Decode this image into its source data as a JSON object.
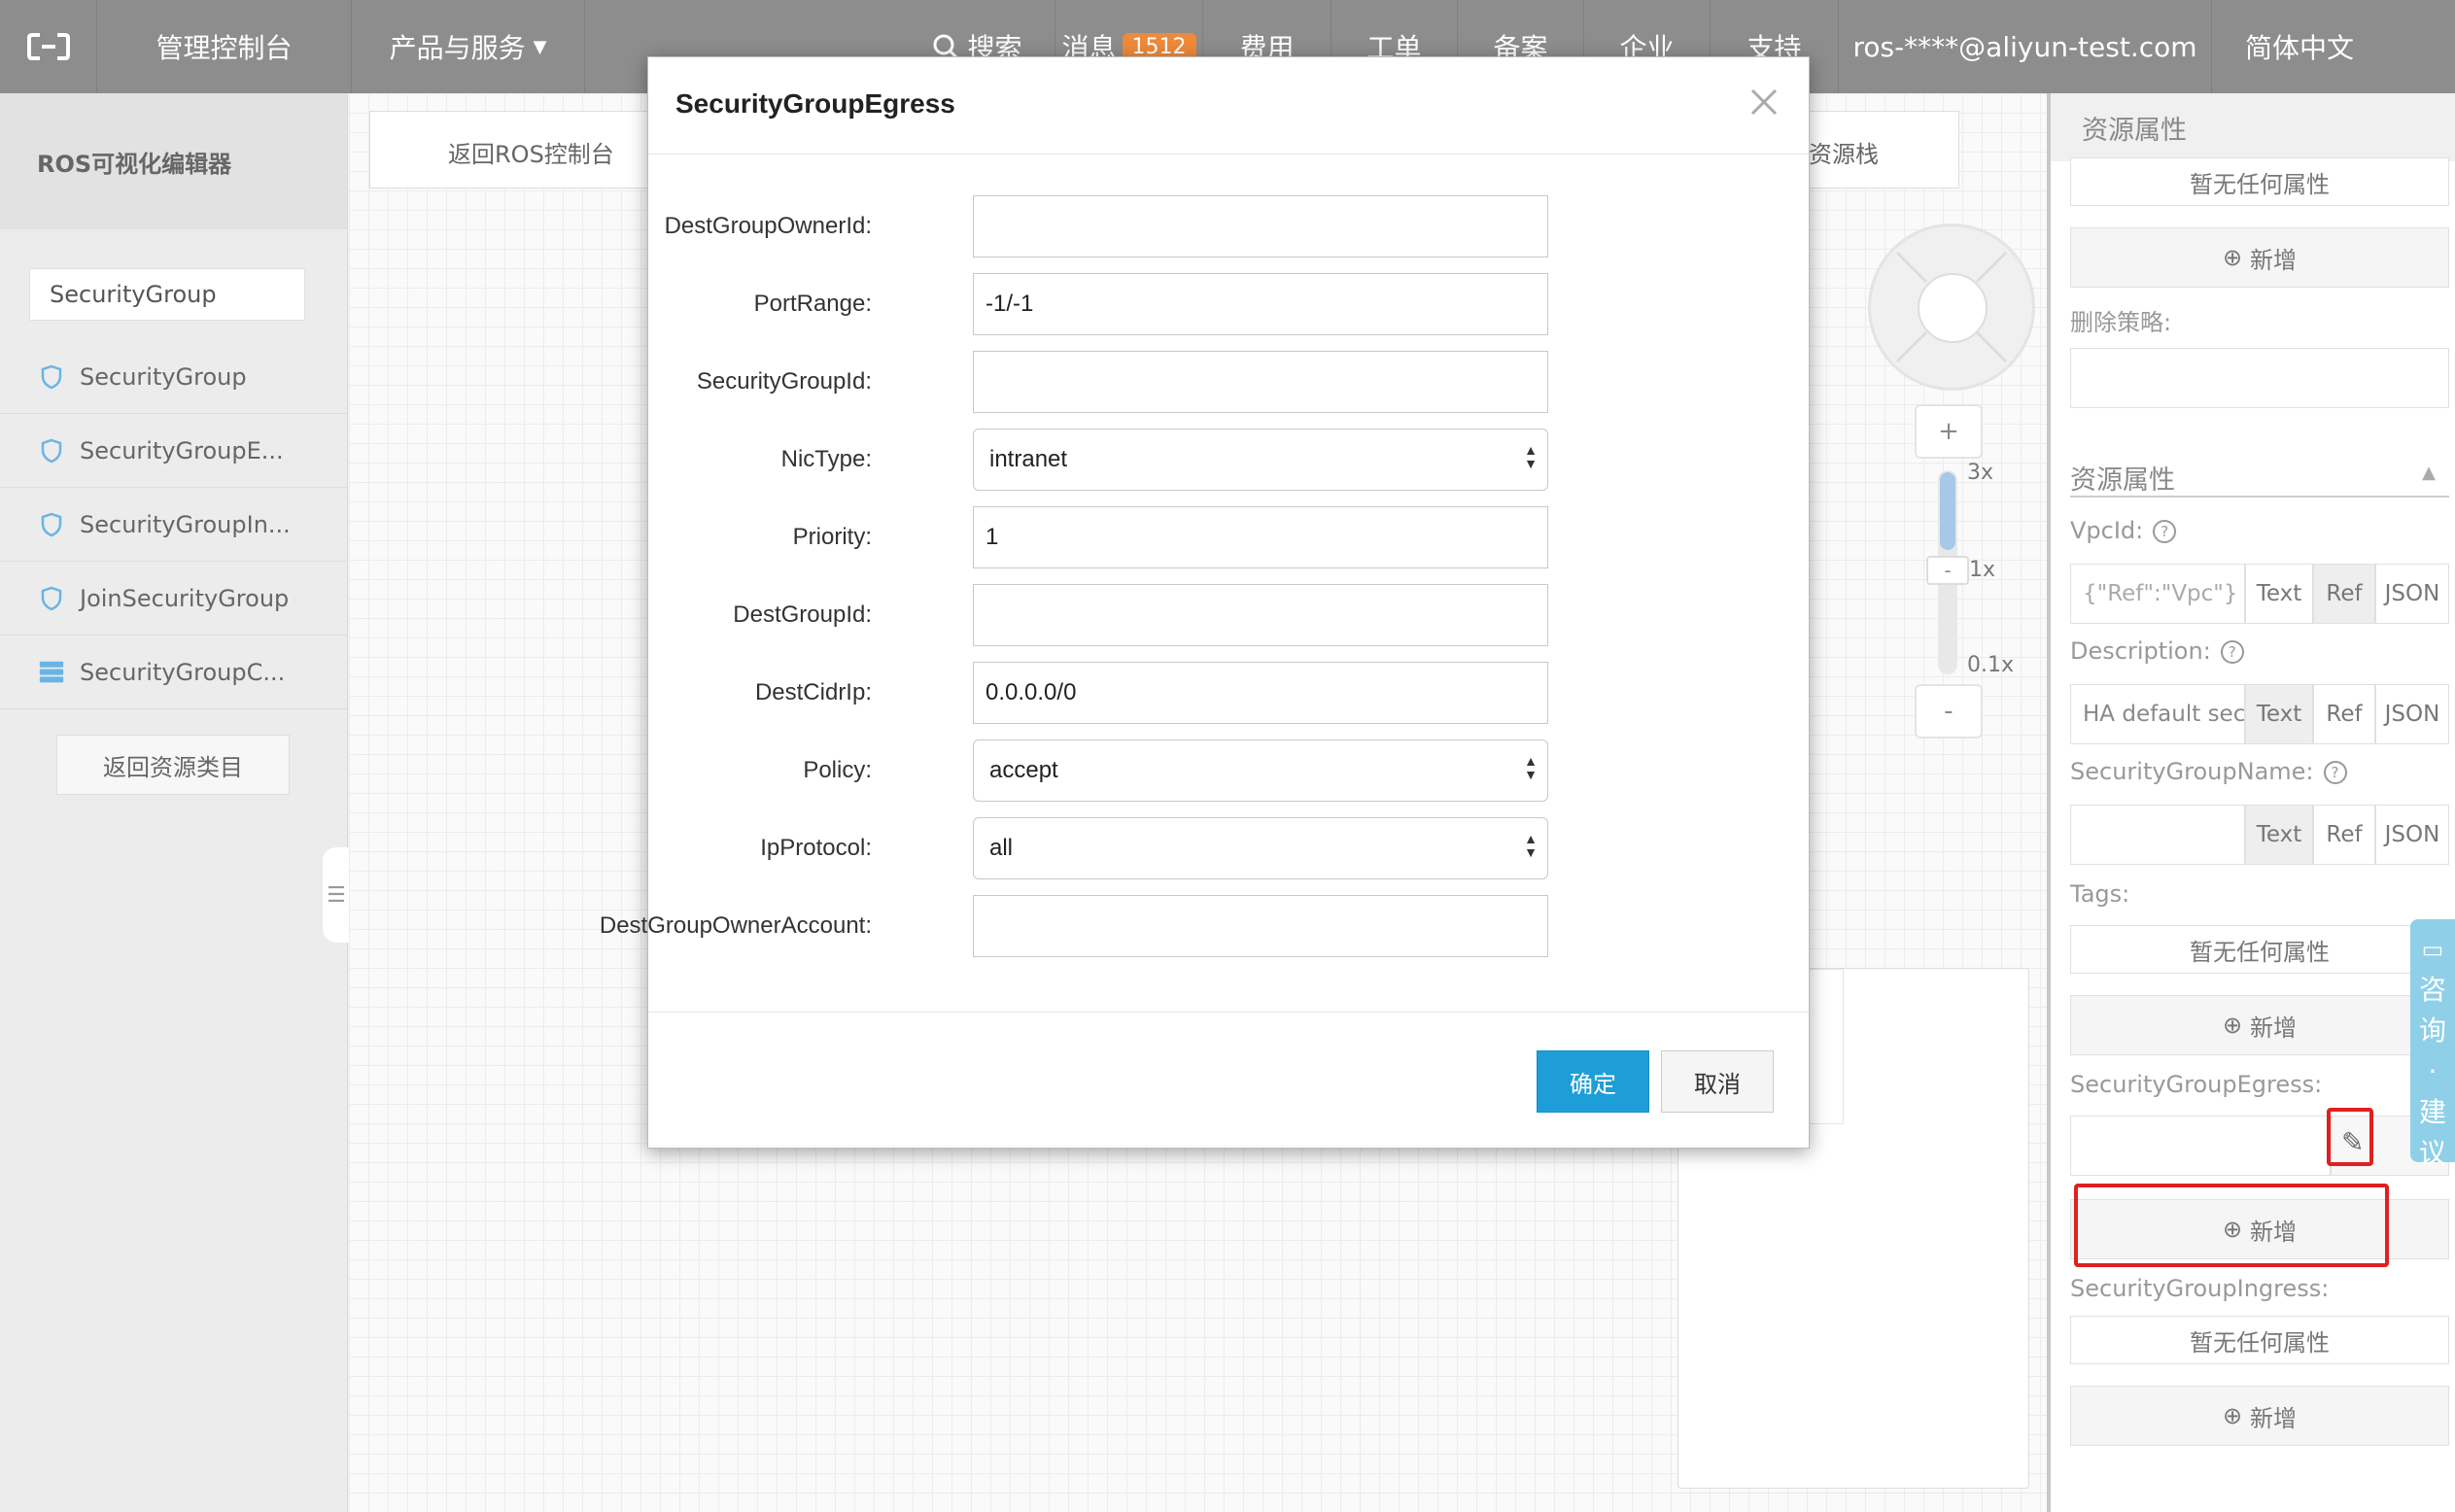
{
  "topbar": {
    "console": "管理控制台",
    "products": "产品与服务",
    "search": "搜索",
    "messages": "消息",
    "message_count": "1512",
    "billing": "费用",
    "tickets": "工单",
    "icp": "备案",
    "enterprise": "企业",
    "support": "支持",
    "account": "ros-****@aliyun-test.com",
    "language": "简体中文"
  },
  "sidebar": {
    "title": "ROS可视化编辑器",
    "search_value": "SecurityGroup",
    "items": [
      {
        "label": "SecurityGroup",
        "icon": "shield-icon"
      },
      {
        "label": "SecurityGroupE...",
        "icon": "shield-icon"
      },
      {
        "label": "SecurityGroupIn...",
        "icon": "shield-icon"
      },
      {
        "label": "JoinSecurityGroup",
        "icon": "shield-icon"
      },
      {
        "label": "SecurityGroupC...",
        "icon": "server-stack-icon"
      }
    ],
    "back_label": "返回资源类目"
  },
  "canvas": {
    "back_console": "返回ROS控制台",
    "stack_label": "资源栈",
    "zoom_in": "+",
    "zoom_out": "-",
    "zoom_handle": "-",
    "zoom_3x": "3x",
    "zoom_1x": "1x",
    "zoom_01x": "0.1x"
  },
  "right_panel": {
    "header": "资源属性",
    "no_props": "暂无任何属性",
    "add": "新增",
    "delete_policy_label": "删除策略:",
    "section_title": "资源属性",
    "vpcid_label": "VpcId:",
    "vpcid_value": "{\"Ref\":\"Vpc\"}",
    "description_label": "Description:",
    "description_value": "HA default sec",
    "sg_name_label": "SecurityGroupName:",
    "tags_label": "Tags:",
    "egress_label": "SecurityGroupEgress:",
    "ingress_label": "SecurityGroupIngress:",
    "seg_text": "Text",
    "seg_ref": "Ref",
    "seg_json": "JSON",
    "side_tab": [
      "咨",
      "询",
      "·",
      "建",
      "议"
    ]
  },
  "modal": {
    "title": "SecurityGroupEgress",
    "fields": [
      {
        "label": "DestGroupOwnerId:",
        "value": "",
        "type": "text"
      },
      {
        "label": "PortRange:",
        "value": "-1/-1",
        "type": "text"
      },
      {
        "label": "SecurityGroupId:",
        "value": "",
        "type": "text"
      },
      {
        "label": "NicType:",
        "value": "intranet",
        "type": "select"
      },
      {
        "label": "Priority:",
        "value": "1",
        "type": "text"
      },
      {
        "label": "DestGroupId:",
        "value": "",
        "type": "text"
      },
      {
        "label": "DestCidrIp:",
        "value": "0.0.0.0/0",
        "type": "text"
      },
      {
        "label": "Policy:",
        "value": "accept",
        "type": "select"
      },
      {
        "label": "IpProtocol:",
        "value": "all",
        "type": "select"
      },
      {
        "label": "DestGroupOwnerAccount:",
        "value": "",
        "type": "text"
      }
    ],
    "ok_label": "确定",
    "cancel_label": "取消"
  },
  "colors": {
    "topbar": "#8d8d8d",
    "primary_button": "#1e9ed8",
    "badge": "#ee8a3a",
    "highlight": "#e02020"
  }
}
